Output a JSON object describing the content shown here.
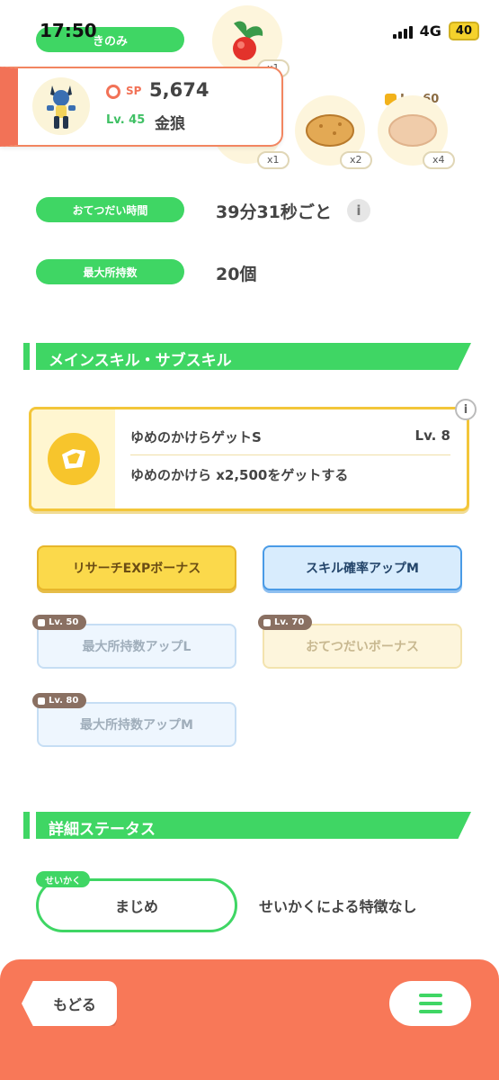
{
  "status_bar": {
    "time": "17:50",
    "network": "4G",
    "battery": "40"
  },
  "ingredients": {
    "label": "きのみ",
    "counts": [
      "x1",
      "x1",
      "x2",
      "x4"
    ],
    "lock_level": "Lv. 60"
  },
  "pokemon": {
    "sp_label": "SP",
    "sp_value": "5,674",
    "level": "Lv. 45",
    "name": "金狼"
  },
  "info": {
    "help_time_label": "おてつだい時間",
    "help_time_value": "39分31秒ごと",
    "max_carry_label": "最大所持数",
    "max_carry_value": "20個"
  },
  "skills_section": {
    "title": "メインスキル・サブスキル"
  },
  "main_skill": {
    "name": "ゆめのかけらゲットS",
    "level": "Lv. 8",
    "description": "ゆめのかけら x2,500をゲットする"
  },
  "sub_skills": [
    {
      "label": "リサーチEXPボーナス",
      "lock": ""
    },
    {
      "label": "スキル確率アップM",
      "lock": ""
    },
    {
      "label": "最大所持数アップL",
      "lock": "Lv. 50"
    },
    {
      "label": "おてつだいボーナス",
      "lock": "Lv. 70"
    },
    {
      "label": "最大所持数アップM",
      "lock": "Lv. 80"
    }
  ],
  "status_section": {
    "title": "詳細ステータス"
  },
  "nature": {
    "tag": "せいかく",
    "value": "まじめ",
    "description": "せいかくによる特徴なし"
  },
  "bottom": {
    "back_label": "もどる"
  }
}
